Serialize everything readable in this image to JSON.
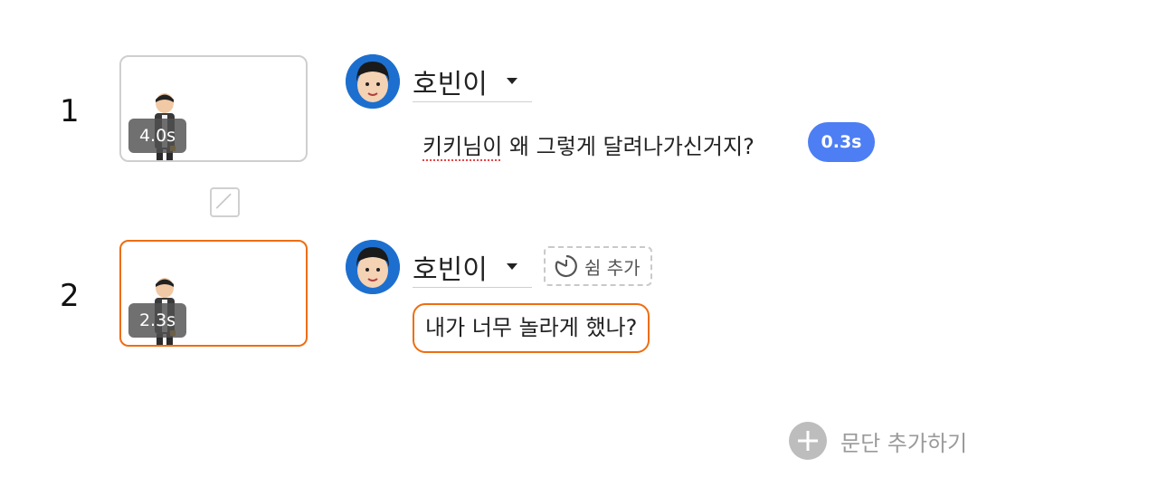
{
  "paragraphs": [
    {
      "number": "1",
      "duration": "4.0s",
      "speaker": "호빈이",
      "text_misspelled": "키키님이",
      "text_rest": " 왜 그렇게 달려나가신거지?",
      "pause": "0.3s"
    },
    {
      "number": "2",
      "duration": "2.3s",
      "speaker": "호빈이",
      "add_pause_label": "쉼 추가",
      "text": "내가 너무 놀라게 했나?"
    }
  ],
  "add_paragraph_label": "문단 추가하기",
  "colors": {
    "accent_orange": "#ee6d10",
    "pause_blue": "#4d7ef3",
    "avatar_ring": "#1d6fcf"
  },
  "icons": [
    "transition-icon",
    "timer-icon",
    "plus-icon",
    "caret-down-icon"
  ]
}
